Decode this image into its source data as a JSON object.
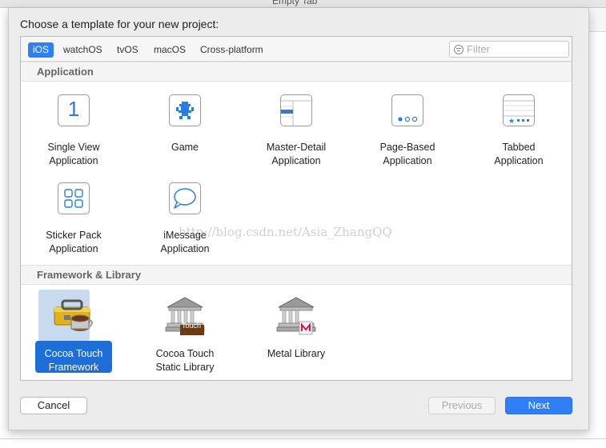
{
  "window": {
    "title": "Empty Tab"
  },
  "sheet": {
    "title": "Choose a template for your new project:"
  },
  "platforms": {
    "tabs": [
      "iOS",
      "watchOS",
      "tvOS",
      "macOS",
      "Cross-platform"
    ],
    "selected": "iOS"
  },
  "filter": {
    "placeholder": "Filter",
    "value": ""
  },
  "sections": {
    "application": {
      "header": "Application",
      "items": [
        {
          "line1": "Single View",
          "line2": "Application",
          "icon": "single-view-icon"
        },
        {
          "line1": "Game",
          "line2": "",
          "icon": "game-icon"
        },
        {
          "line1": "Master-Detail",
          "line2": "Application",
          "icon": "master-detail-icon"
        },
        {
          "line1": "Page-Based",
          "line2": "Application",
          "icon": "page-based-icon"
        },
        {
          "line1": "Tabbed",
          "line2": "Application",
          "icon": "tabbed-icon"
        },
        {
          "line1": "Sticker Pack",
          "line2": "Application",
          "icon": "sticker-pack-icon"
        },
        {
          "line1": "iMessage",
          "line2": "Application",
          "icon": "imessage-icon"
        }
      ]
    },
    "framework": {
      "header": "Framework & Library",
      "items": [
        {
          "line1": "Cocoa Touch",
          "line2": "Framework",
          "icon": "toolbox-icon",
          "selected": true
        },
        {
          "line1": "Cocoa Touch",
          "line2": "Static Library",
          "icon": "library-building-icon",
          "badge": "Touch"
        },
        {
          "line1": "Metal Library",
          "line2": "",
          "icon": "metal-library-icon"
        }
      ]
    }
  },
  "single_view_digit": "1",
  "watermark": "http://blog.csdn.net/Asia_ZhangQQ",
  "buttons": {
    "cancel": "Cancel",
    "previous": "Previous",
    "next": "Next"
  },
  "colors": {
    "accent": "#2f7ff7",
    "selected_bg": "#c8dbee",
    "selected_label": "#1e6ed8"
  }
}
